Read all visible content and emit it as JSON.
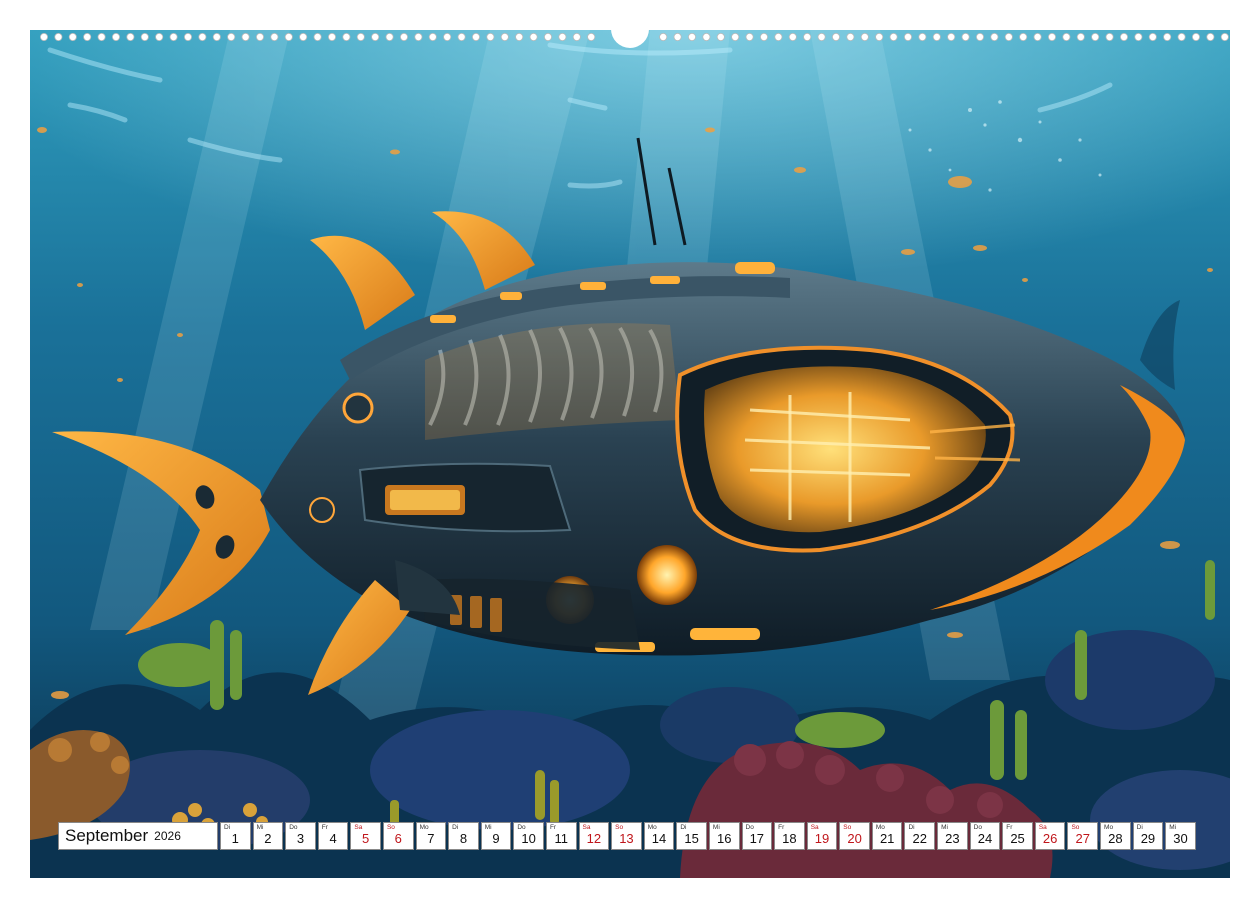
{
  "colors": {
    "water_top": "#2f9dbd",
    "water_mid": "#12587e",
    "water_deep": "#0a2b44",
    "accent_orange": "#f2a23a",
    "glow_yellow": "#ffcf5a",
    "hull_dark": "#1f3342",
    "weekend_red": "#c0161b"
  },
  "illustration": {
    "name": "underwater-submarine-shark-artwork",
    "icons": [
      "wire-binding-rings",
      "hanger-notch"
    ]
  },
  "calendar": {
    "month": "September",
    "year": "2026",
    "days": [
      {
        "wd": "Di",
        "n": "1",
        "we": false
      },
      {
        "wd": "Mi",
        "n": "2",
        "we": false
      },
      {
        "wd": "Do",
        "n": "3",
        "we": false
      },
      {
        "wd": "Fr",
        "n": "4",
        "we": false
      },
      {
        "wd": "Sa",
        "n": "5",
        "we": true
      },
      {
        "wd": "So",
        "n": "6",
        "we": true
      },
      {
        "wd": "Mo",
        "n": "7",
        "we": false
      },
      {
        "wd": "Di",
        "n": "8",
        "we": false
      },
      {
        "wd": "Mi",
        "n": "9",
        "we": false
      },
      {
        "wd": "Do",
        "n": "10",
        "we": false
      },
      {
        "wd": "Fr",
        "n": "11",
        "we": false
      },
      {
        "wd": "Sa",
        "n": "12",
        "we": true
      },
      {
        "wd": "So",
        "n": "13",
        "we": true
      },
      {
        "wd": "Mo",
        "n": "14",
        "we": false
      },
      {
        "wd": "Di",
        "n": "15",
        "we": false
      },
      {
        "wd": "Mi",
        "n": "16",
        "we": false
      },
      {
        "wd": "Do",
        "n": "17",
        "we": false
      },
      {
        "wd": "Fr",
        "n": "18",
        "we": false
      },
      {
        "wd": "Sa",
        "n": "19",
        "we": true
      },
      {
        "wd": "So",
        "n": "20",
        "we": true
      },
      {
        "wd": "Mo",
        "n": "21",
        "we": false
      },
      {
        "wd": "Di",
        "n": "22",
        "we": false
      },
      {
        "wd": "Mi",
        "n": "23",
        "we": false
      },
      {
        "wd": "Do",
        "n": "24",
        "we": false
      },
      {
        "wd": "Fr",
        "n": "25",
        "we": false
      },
      {
        "wd": "Sa",
        "n": "26",
        "we": true
      },
      {
        "wd": "So",
        "n": "27",
        "we": true
      },
      {
        "wd": "Mo",
        "n": "28",
        "we": false
      },
      {
        "wd": "Di",
        "n": "29",
        "we": false
      },
      {
        "wd": "Mi",
        "n": "30",
        "we": false
      }
    ]
  }
}
